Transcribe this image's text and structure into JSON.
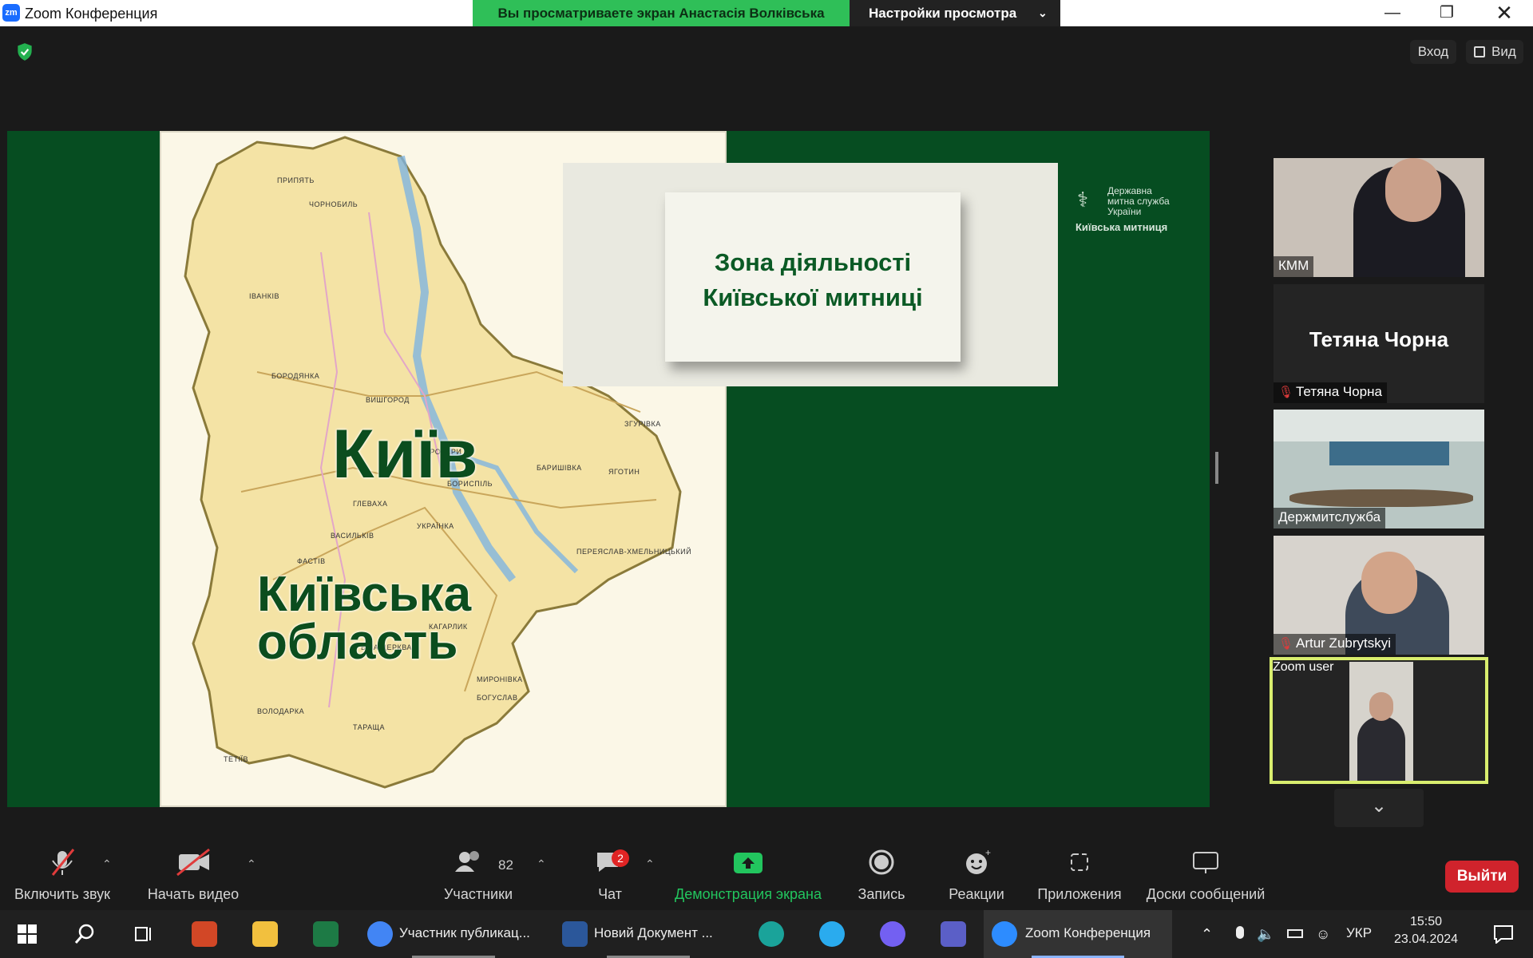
{
  "window": {
    "app_icon_text": "zm",
    "title": "Zoom Конференция",
    "share_banner": "Вы просматриваете экран Анастасія Волківська",
    "view_options": "Настройки просмотра",
    "controls": [
      "minimize-icon",
      "restore-icon",
      "close-icon"
    ]
  },
  "top_bar": {
    "enter_label": "Вход",
    "view_label": "Вид",
    "security_icon": "shield-check-icon"
  },
  "slide": {
    "map_labels": {
      "city": "Київ",
      "region_line1": "Київська",
      "region_line2": "область"
    },
    "map_towns": [
      "ПРИПЯТЬ",
      "ЧОРНОБИЛЬ",
      "ІВАНКІВ",
      "БОРОДЯНКА",
      "ВИШГОРОД",
      "БРОВАРИ",
      "БОРИСПІЛЬ",
      "ФАСТІВ",
      "УКРАЇНКА",
      "ПЕРЕЯСЛАВ-ХМЕЛЬНИЦЬКИЙ",
      "КАГАРЛИК",
      "МИРОНІВКА",
      "БОГУСЛАВ",
      "ТАРАЩА",
      "ТЕТІЇВ",
      "ЯГОТИН",
      "ЗГУРІВКА",
      "БАРИШІВКА",
      "ГЛЕВАХА",
      "ВАСИЛЬКІВ",
      "БІЛА ЦЕРКВА",
      "ВОЛОДАРКА"
    ],
    "card_title_line1": "Зона діяльності",
    "card_title_line2": "Київської митниці",
    "logo_line1": "Державна",
    "logo_line2": "митна служба",
    "logo_line3": "України",
    "logo_sub": "Київська митниця"
  },
  "participants": [
    {
      "name": "КММ",
      "muted": false,
      "video": true,
      "avatar_text": ""
    },
    {
      "name": "Тетяна Чорна",
      "muted": true,
      "video": false,
      "avatar_text": "Тетяна Чорна"
    },
    {
      "name": "Держмитслужба",
      "muted": false,
      "video": true,
      "avatar_text": ""
    },
    {
      "name": "Artur Zubrytskyi",
      "muted": true,
      "video": true,
      "avatar_text": ""
    },
    {
      "name": "Zoom user",
      "muted": false,
      "video": true,
      "avatar_text": "",
      "active_speaker": true
    }
  ],
  "toolbar": {
    "unmute": "Включить звук",
    "start_video": "Начать видео",
    "participants": "Участники",
    "participants_count": "82",
    "chat": "Чат",
    "chat_badge": "2",
    "share": "Демонстрация экрана",
    "record": "Запись",
    "reactions": "Реакции",
    "apps": "Приложения",
    "whiteboards": "Доски сообщений",
    "leave": "Выйти"
  },
  "taskbar": {
    "chrome_title": "Участник публикац...",
    "word_title": "Новий Документ ...",
    "zoom_title": "Zoom Конференция",
    "lang": "УКР",
    "time": "15:50",
    "date": "23.04.2024"
  },
  "colors": {
    "slide_green": "#064d21",
    "share_banner": "#2fbf58",
    "leave_red": "#d0232c",
    "active_border": "#d9ee6e",
    "share_icon_green": "#22c55e",
    "muted_red": "#e03b3b"
  }
}
